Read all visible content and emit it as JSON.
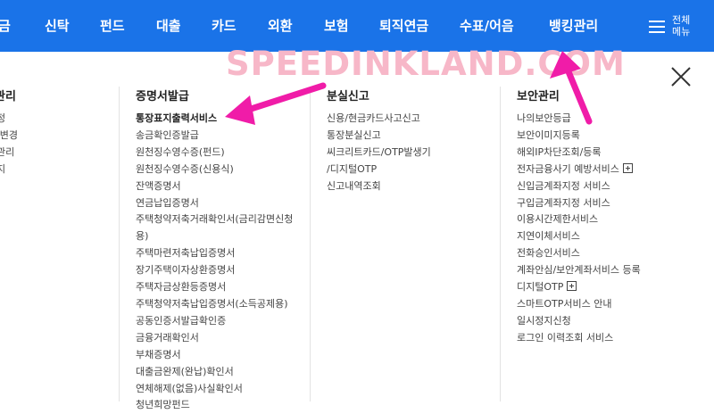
{
  "top_nav": {
    "items": [
      "금",
      "신탁",
      "펀드",
      "대출",
      "카드",
      "외환",
      "보험",
      "퇴직연금",
      "수표/어음",
      "뱅킹관리"
    ],
    "all_menu_label": "전체 메뉴"
  },
  "watermark": "SPEEDINKLAND.COM",
  "columns": {
    "col0": {
      "title": "관리",
      "items": [
        "정",
        "",
        "/변경",
        "관리",
        "지"
      ]
    },
    "col1": {
      "title": "증명서발급",
      "items": [
        "통장표지출력서비스",
        "송금확인증발급",
        "원천징수영수증(펀드)",
        "원천징수영수증(신용식)",
        "잔액증명서",
        "연금납입증명서",
        "주택청약저축거래확인서(금리감면신청",
        "용)",
        "주택마련저축납입증명서",
        "장기주택이자상환증명서",
        "주택자금상환등증명서",
        "주택청약저축납입증명서(소득공제용)",
        "공동인증서발급확인증",
        "금융거래확인서",
        "부채증명서",
        "대출금완제(완납)확인서",
        "연체해제(없음)사실확인서",
        "청년희망펀드"
      ]
    },
    "col2": {
      "title": "분실신고",
      "items": [
        "신용/현금카드사고신고",
        "통장분실신고",
        "씨크리트카드/OTP발생기",
        "/디지털OTP",
        "신고내역조회"
      ]
    },
    "col3": {
      "title": "보안관리",
      "items": [
        "나의보안등급",
        "보안이미지등록",
        "해외IP차단조회/등록",
        "전자금융사기 예방서비스",
        "신입금계좌지정 서비스",
        "구입금계좌지정 서비스",
        "이용시간제한서비스",
        "지연이체서비스",
        "전화승인서비스",
        "계좌안심/보안계좌서비스 등록",
        "디지털OTP",
        "스마트OTP서비스 안내",
        "일시정지신청",
        "로그인 이력조회 서비스"
      ]
    }
  },
  "colors": {
    "nav_bg": "#1a73e8",
    "arrow": "#f01ca8",
    "watermark": "#f7b7c8"
  },
  "icons": [
    "hamburger-icon",
    "close-icon",
    "plus-box-icon",
    "arrow-annotation"
  ]
}
